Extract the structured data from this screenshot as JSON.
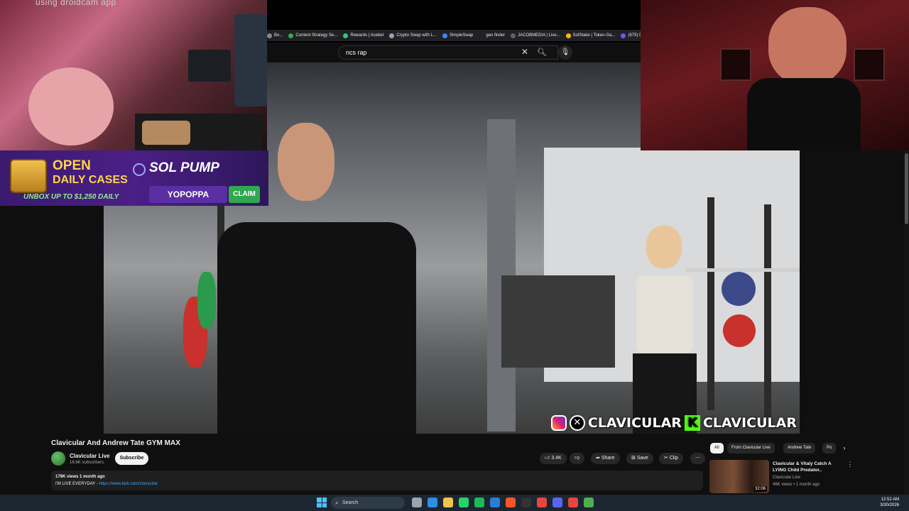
{
  "webcam_left": {
    "caption": "using droidcam app"
  },
  "ad": {
    "headline1": "OPEN",
    "headline2": "DAILY CASES",
    "tagline": "UNBOX UP TO $1,250 DAILY",
    "brand": "SOL PUMP",
    "promo_code": "YOPOPPA",
    "claim_label": "CLAIM"
  },
  "browser": {
    "bookmarks": [
      {
        "label": "Bo...",
        "color": "#888888"
      },
      {
        "label": "Content Strategy Se...",
        "color": "#34a853"
      },
      {
        "label": "Rewards | Acebet",
        "color": "#2ecc71"
      },
      {
        "label": "Crypto Swap with L...",
        "color": "#9aa0a6"
      },
      {
        "label": "SimpleSwap",
        "color": "#4285f4"
      },
      {
        "label": "geo finder",
        "color": "#202124"
      },
      {
        "label": "JACOBMEDIA | Live...",
        "color": "#5f6368"
      },
      {
        "label": "SolStake | Token-Ga...",
        "color": "#fbbc04"
      },
      {
        "label": "(675) Dis",
        "color": "#7c4dff"
      }
    ],
    "search_value": "ncs rap"
  },
  "video": {
    "watermark_text1": "CLAVICULAR",
    "watermark_text2": "CLAVICULAR"
  },
  "info": {
    "title": "Clavicular And Andrew Tate GYM MAX",
    "channel_name": "Clavicular Live",
    "subscribers": "16.6K subscribers",
    "subscribe_label": "Subscribe",
    "like_count": "3.4K",
    "share_label": "Share",
    "save_label": "Save",
    "clip_label": "Clip",
    "more_label": "⋯",
    "stats": "179K views  1 month ago",
    "description": "I'M LIVE EVERYDAY - ",
    "description_link": "https://www.kick.com/clavicular"
  },
  "related": {
    "chips": [
      "All",
      "From Clavicular Live",
      "Andrew Tate",
      "Po"
    ],
    "item": {
      "title": "Clavicular & Vitaly Catch A LYING Child Predator..",
      "channel": "Clavicular Live",
      "meta": "46K views • 1 month ago",
      "duration": "32:06"
    }
  },
  "taskbar": {
    "search_placeholder": "Search",
    "time": "12:52 AM",
    "date": "3/30/2026",
    "apps": [
      {
        "name": "file-explorer-icon",
        "color": "#9aa5b1"
      },
      {
        "name": "edge-icon",
        "color": "#2b8fe8"
      },
      {
        "name": "folder-icon",
        "color": "#f3c24b"
      },
      {
        "name": "whatsapp-icon",
        "color": "#25d366"
      },
      {
        "name": "spotify-icon",
        "color": "#1db954"
      },
      {
        "name": "vscode-icon",
        "color": "#2a7dd6"
      },
      {
        "name": "brave-icon",
        "color": "#fb542b"
      },
      {
        "name": "terminal-icon",
        "color": "#333333"
      },
      {
        "name": "chrome-icon",
        "color": "#e8453c"
      },
      {
        "name": "discord-icon",
        "color": "#5865f2"
      },
      {
        "name": "chrome-alt-icon",
        "color": "#e8453c"
      },
      {
        "name": "chrome-profile-icon",
        "color": "#4caf50"
      }
    ]
  }
}
